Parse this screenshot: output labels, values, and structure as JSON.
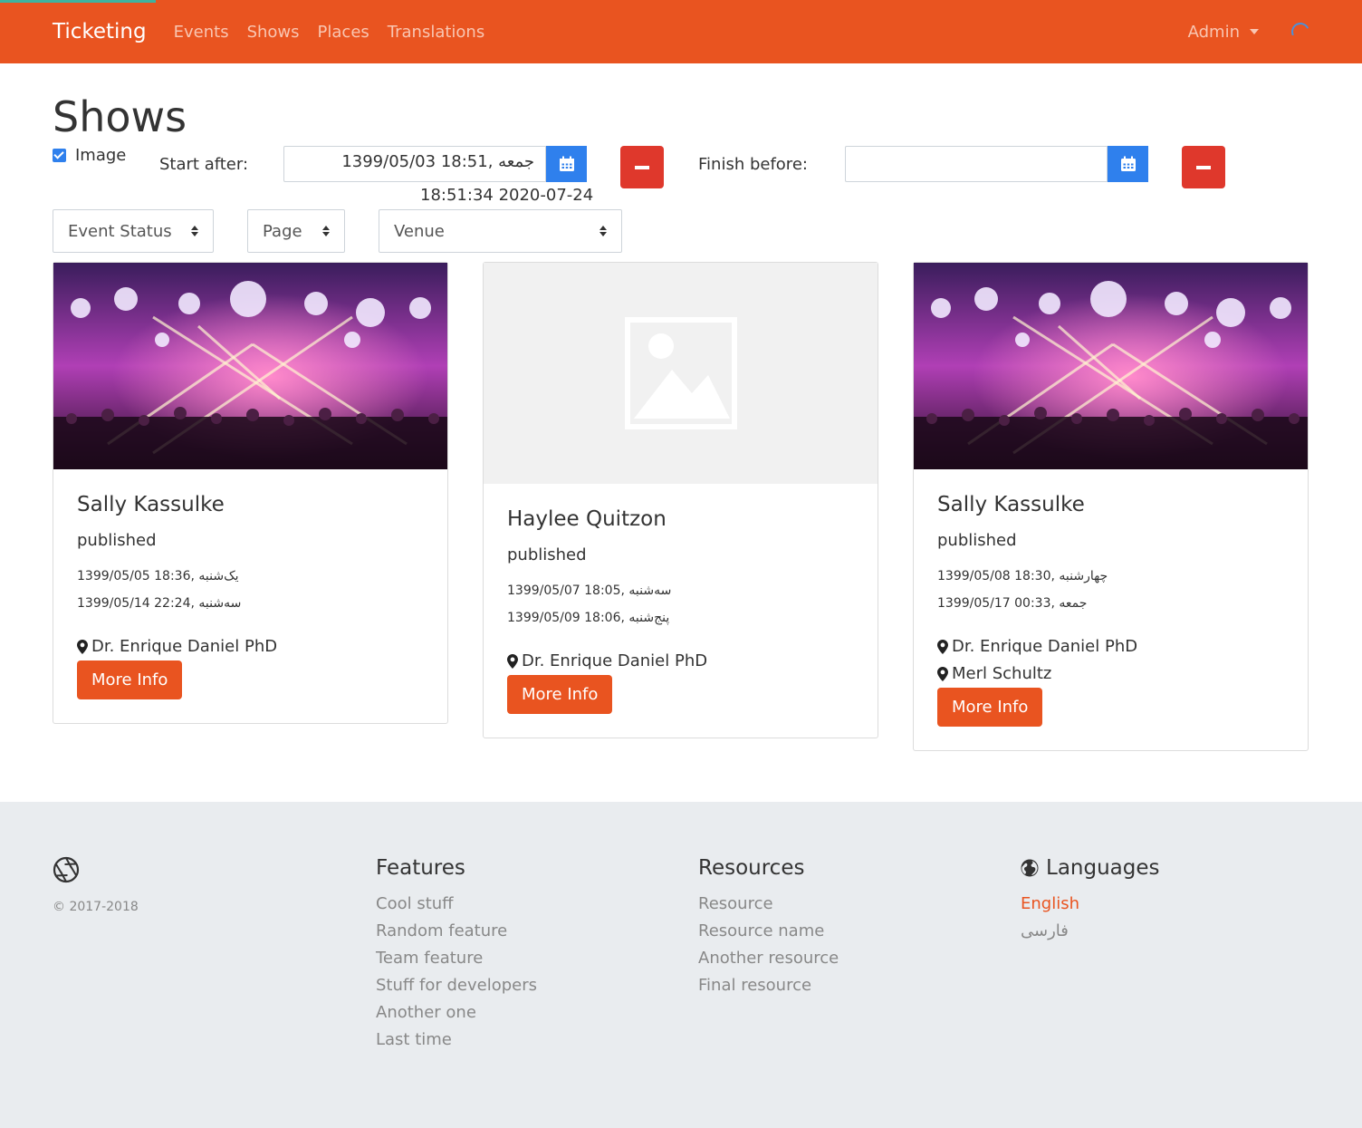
{
  "navbar": {
    "brand": "Ticketing",
    "links": [
      "Events",
      "Shows",
      "Places",
      "Translations"
    ],
    "user_menu": "Admin",
    "brand_color": "#e95420"
  },
  "page": {
    "title": "Shows"
  },
  "filters": {
    "image_checkbox_label": "Image",
    "image_checked": true,
    "start_after_label": "Start after:",
    "start_after_value": "جمعه ,18:51 1399/05/03",
    "start_after_gregorian": "18:51:34 2020-07-24",
    "finish_before_label": "Finish before:",
    "finish_before_value": "",
    "selects": [
      "Event Status",
      "Page",
      "Venue"
    ]
  },
  "cards": [
    {
      "title": "Sally Kassulke",
      "status": "published",
      "start": "1399/05/05 18:36, یک‌شنبه",
      "end": "1399/05/14 22:24, سه‌شنبه",
      "venues": [
        "Dr. Enrique Daniel PhD"
      ],
      "button": "More Info",
      "has_image": true
    },
    {
      "title": "Haylee Quitzon",
      "status": "published",
      "start": "1399/05/07 18:05, سه‌شنبه",
      "end": "1399/05/09 18:06, پنج‌شنبه",
      "venues": [
        "Dr. Enrique Daniel PhD"
      ],
      "button": "More Info",
      "has_image": false
    },
    {
      "title": "Sally Kassulke",
      "status": "published",
      "start": "1399/05/08 18:30, چهارشنبه",
      "end": "1399/05/17 00:33, جمعه",
      "venues": [
        "Dr. Enrique Daniel PhD",
        "Merl Schultz"
      ],
      "button": "More Info",
      "has_image": true
    }
  ],
  "footer": {
    "copyright": "© 2017-2018",
    "features": {
      "heading": "Features",
      "links": [
        "Cool stuff",
        "Random feature",
        "Team feature",
        "Stuff for developers",
        "Another one",
        "Last time"
      ]
    },
    "resources": {
      "heading": "Resources",
      "links": [
        "Resource",
        "Resource name",
        "Another resource",
        "Final resource"
      ]
    },
    "languages": {
      "heading": "Languages",
      "links": [
        "English",
        "فارسی"
      ],
      "active": "English"
    }
  }
}
